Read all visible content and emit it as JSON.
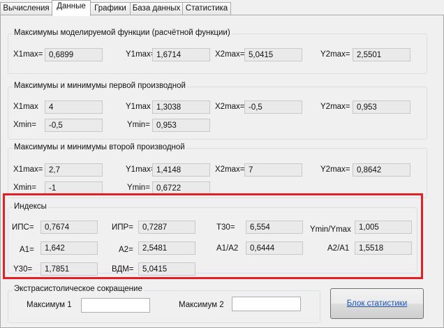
{
  "tabs": [
    "Вычисления",
    "Данные",
    "Графики",
    "База данных",
    "Статистика"
  ],
  "g1": {
    "title": "Максимумы моделируемой функции (расчётной функции)",
    "x1max_label": "X1max=",
    "x1max": "0,6899",
    "y1max_label": "Y1max=",
    "y1max": "1,6714",
    "x2max_label": "X2max=",
    "x2max": "5,0415",
    "y2max_label": "Y2max=",
    "y2max": "2,5501"
  },
  "g2": {
    "title": "Максимумы и минимумы первой производной",
    "x1max_label": "X1max",
    "x1max": "4",
    "y1max_label": "Y1max",
    "y1max": "1,3038",
    "x2max_label": "X2max=",
    "x2max": "-0,5",
    "y2max_label": "Y2max=",
    "y2max": "0,953",
    "xmin_label": "Xmin=",
    "xmin": "-0,5",
    "ymin_label": "Ymin=",
    "ymin": "0,953"
  },
  "g3": {
    "title": "Максимумы и минимумы второй производной",
    "x1max_label": "X1max=",
    "x1max": "2,7",
    "y1max_label": "Y1max=",
    "y1max": "1,4148",
    "x2max_label": "X2max=",
    "x2max": "7",
    "y2max_label": "Y2max=",
    "y2max": "0,8642",
    "xmin_label": "Xmin=",
    "xmin": "-1",
    "ymin_label": "Ymin=",
    "ymin": "0,6722"
  },
  "g4": {
    "title": "Индексы",
    "ips_label": "ИПС=",
    "ips": "0,7674",
    "ipr_label": "ИПР=",
    "ipr": "0,7287",
    "t30_label": "T30=",
    "t30": "6,554",
    "yminymax_label": "Ymin/Ymax",
    "yminymax": "1,005",
    "a1_label": "A1=",
    "a1": "1,642",
    "a2_label": "A2=",
    "a2": "2,5481",
    "a1a2_label": "A1/A2",
    "a1a2": "0,6444",
    "a2a1_label": "A2/A1",
    "a2a1": "1,5518",
    "y30_label": "Y30=",
    "y30": "1,7851",
    "vdm_label": "ВДМ=",
    "vdm": "5,0415"
  },
  "g5": {
    "title": "Экстрасистолическое сокращение",
    "max1_label": "Максимум 1",
    "max1": "",
    "max2_label": "Максимум 2",
    "max2": ""
  },
  "stats_button": "Блок статистики"
}
